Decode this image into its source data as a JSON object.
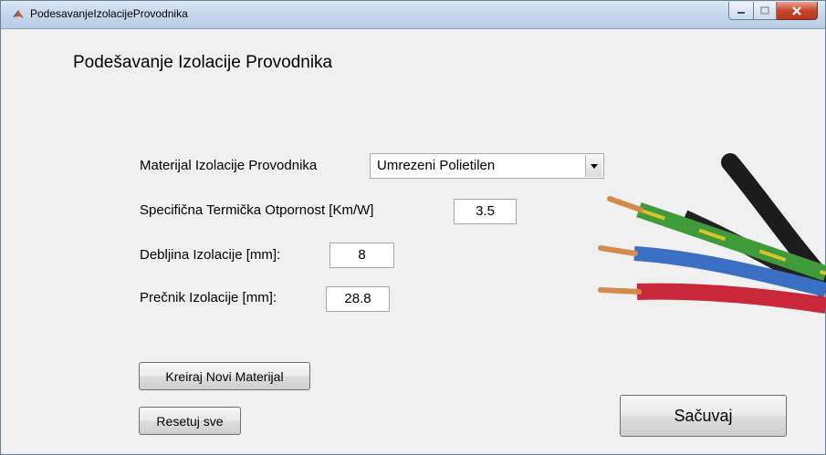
{
  "window": {
    "title": "PodesavanjeIzolacijeProvodnika",
    "controls": {
      "minimize_icon": "minimize-icon",
      "maximize_icon": "maximize-icon",
      "close_icon": "close-icon"
    }
  },
  "form": {
    "heading": "Podešavanje Izolacije Provodnika",
    "material": {
      "label": "Materijal Izolacije Provodnika",
      "value": "Umrezeni Polietilen"
    },
    "thermal_resistance": {
      "label": "Specifična Termička Otpornost [Km/W]",
      "value": "3.5"
    },
    "thickness": {
      "label": "Debljina Izolacije [mm]:",
      "value": "8"
    },
    "diameter": {
      "label": "Prečnik Izolacije [mm]:",
      "value": "28.8"
    }
  },
  "buttons": {
    "new_material": "Kreiraj Novi Materijal",
    "reset": "Resetuj sve",
    "save": "Sačuvaj"
  },
  "colors": {
    "wire_green_yellow": "#3f9a3a",
    "wire_blue": "#3a6fc4",
    "wire_red": "#c8283a",
    "wire_black": "#1c1c1c",
    "copper": "#d48a4a"
  }
}
